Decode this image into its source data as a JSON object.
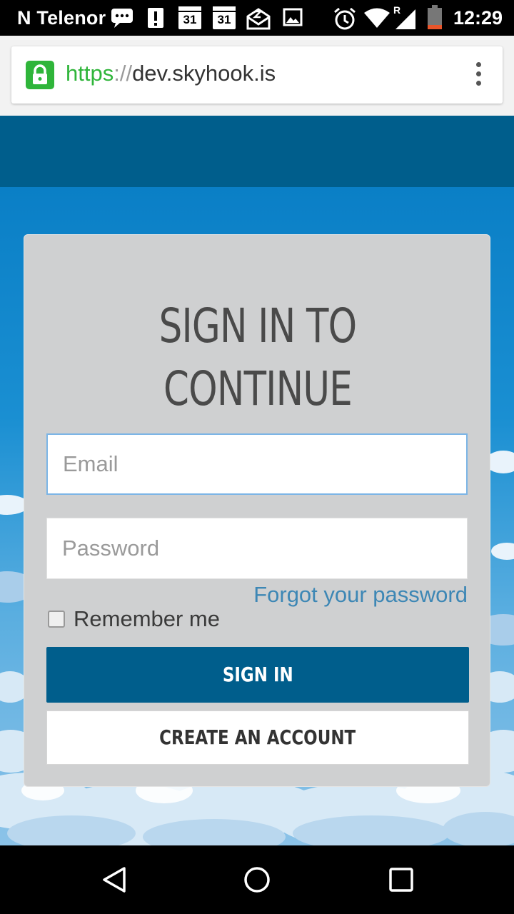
{
  "status_bar": {
    "carrier": "N Telenor",
    "calendar_day_1": "31",
    "calendar_day_2": "31",
    "time": "12:29",
    "signal_label": "R",
    "icons": [
      "chat-bubble-icon",
      "alert-icon",
      "calendar-icon",
      "calendar-icon",
      "mail-icon",
      "image-icon",
      "alarm-icon",
      "wifi-icon",
      "signal-icon",
      "battery-icon"
    ]
  },
  "browser": {
    "url_scheme": "https",
    "url_separator": "://",
    "url_host": "dev.skyhook.is",
    "secure": true,
    "icons": [
      "lock-icon",
      "menu-kebab-icon"
    ]
  },
  "signin_card": {
    "title_line1": "SIGN IN TO",
    "title_line2": "CONTINUE",
    "email_placeholder": "Email",
    "password_placeholder": "Password",
    "forgot_link": "Forgot your password",
    "remember_label": "Remember me",
    "remember_checked": false,
    "signin_button": "SIGN IN",
    "create_button": "CREATE AN ACCOUNT"
  },
  "nav_bar": {
    "icons": [
      "back-icon",
      "home-icon",
      "recents-icon"
    ]
  },
  "colors": {
    "header": "#005e8c",
    "signin_button": "#005e8c",
    "link": "#3d87b5",
    "secure_green": "#2fb53a",
    "card": "#cfd0d1"
  }
}
